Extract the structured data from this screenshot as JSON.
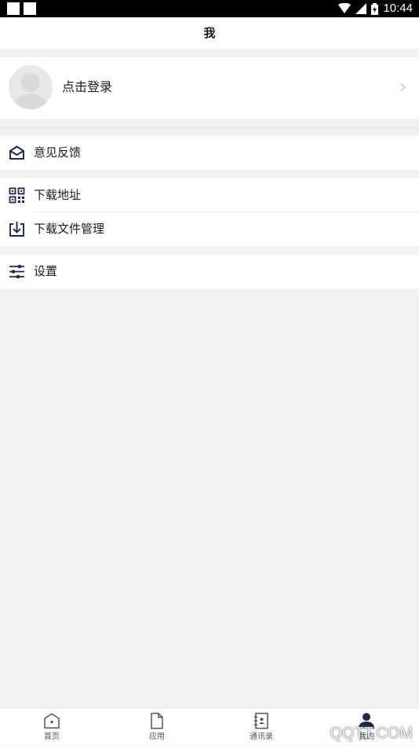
{
  "status_bar": {
    "time": "10:44"
  },
  "header": {
    "title": "我"
  },
  "profile": {
    "login_label": "点击登录"
  },
  "menu": {
    "feedback": "意见反馈",
    "download_address": "下载地址",
    "download_manager": "下载文件管理",
    "settings": "设置"
  },
  "tabs": [
    {
      "label": "首页",
      "icon": "home-icon"
    },
    {
      "label": "应用",
      "icon": "file-icon"
    },
    {
      "label": "通讯录",
      "icon": "contacts-icon"
    },
    {
      "label": "我的",
      "icon": "user-icon"
    }
  ],
  "watermark": "QQTT.COM",
  "colors": {
    "icon_dark": "#1e2a4a",
    "background": "#f2f2f2"
  }
}
